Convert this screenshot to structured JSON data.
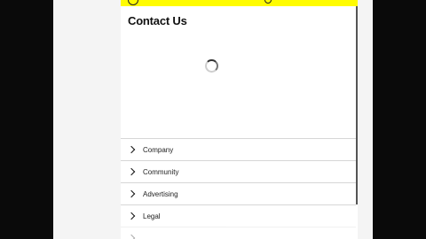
{
  "page": {
    "title": "Contact Us",
    "header_color": "#fffc00"
  },
  "header": {
    "logo_icon": "ghost-icon",
    "search_icon": "search-icon"
  },
  "loading": {
    "icon": "spinner-icon"
  },
  "menu": {
    "items": [
      {
        "label": "Company"
      },
      {
        "label": "Community"
      },
      {
        "label": "Advertising"
      },
      {
        "label": "Legal"
      }
    ]
  }
}
